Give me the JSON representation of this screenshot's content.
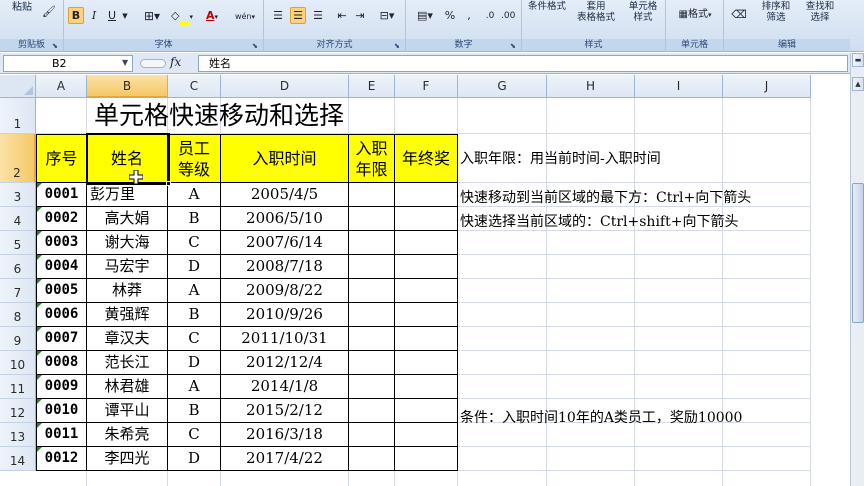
{
  "ribbon": {
    "clipboard": {
      "paste_label": "粘贴",
      "group_label": "剪贴板"
    },
    "font": {
      "bold": "B",
      "italic": "I",
      "underline": "U",
      "font_color_glyph": "A",
      "highlight_glyph": "A",
      "wen_glyph": "wén",
      "group_label": "字体"
    },
    "alignment": {
      "group_label": "对齐方式"
    },
    "number": {
      "percent": "%",
      "comma": ",",
      "group_label": "数字"
    },
    "styles": {
      "conditional_format": "条件格式",
      "table_format_1": "套用",
      "table_format_2": "表格格式",
      "cell_style_1": "单元格",
      "cell_style_2": "样式",
      "group_label": "样式"
    },
    "cells": {
      "format_label": "格式",
      "group_label": "单元格"
    },
    "editing": {
      "sort_filter_1": "排序和",
      "sort_filter_2": "筛选",
      "find_select_1": "查找和",
      "find_select_2": "选择",
      "group_label": "编辑"
    }
  },
  "formula_bar": {
    "name_box": "B2",
    "fx": "fx",
    "content": "姓名"
  },
  "columns": [
    "A",
    "B",
    "C",
    "D",
    "E",
    "F",
    "G",
    "H",
    "I",
    "J"
  ],
  "rows": [
    "1",
    "2",
    "3",
    "4",
    "5",
    "6",
    "7",
    "8",
    "9",
    "10",
    "11",
    "12",
    "13",
    "14"
  ],
  "sheet": {
    "title": "单元格快速移动和选择",
    "headers": {
      "seq": "序号",
      "name": "姓名",
      "grade_1": "员工",
      "grade_2": "等级",
      "hire_date": "入职时间",
      "years_1": "入职",
      "years_2": "年限",
      "bonus": "年终奖"
    },
    "records": [
      {
        "id": "0001",
        "name": "彭万里",
        "grade": "A",
        "date": "2005/4/5"
      },
      {
        "id": "0002",
        "name": "高大娟",
        "grade": "B",
        "date": "2006/5/10"
      },
      {
        "id": "0003",
        "name": "谢大海",
        "grade": "C",
        "date": "2007/6/14"
      },
      {
        "id": "0004",
        "name": "马宏宇",
        "grade": "D",
        "date": "2008/7/18"
      },
      {
        "id": "0005",
        "name": "林莽",
        "grade": "A",
        "date": "2009/8/22"
      },
      {
        "id": "0006",
        "name": "黄强辉",
        "grade": "B",
        "date": "2010/9/26"
      },
      {
        "id": "0007",
        "name": "章汉夫",
        "grade": "C",
        "date": "2011/10/31"
      },
      {
        "id": "0008",
        "name": "范长江",
        "grade": "D",
        "date": "2012/12/4"
      },
      {
        "id": "0009",
        "name": "林君雄",
        "grade": "A",
        "date": "2014/1/8"
      },
      {
        "id": "0010",
        "name": "谭平山",
        "grade": "B",
        "date": "2015/2/12"
      },
      {
        "id": "0011",
        "name": "朱希亮",
        "grade": "C",
        "date": "2016/3/18"
      },
      {
        "id": "0012",
        "name": "李四光",
        "grade": "D",
        "date": "2017/4/22"
      }
    ],
    "notes": {
      "years_formula": "入职年限：用当前时间-入职时间",
      "move_tip": "快速移动到当前区域的最下方：Ctrl+向下箭头",
      "select_tip": "快速选择当前区域的：Ctrl+shift+向下箭头",
      "condition": "条件：入职时间10年的A类员工，奖励10000"
    }
  },
  "colors": {
    "header_fill": "#ffff00",
    "selection_header": "#f5c866",
    "ribbon": "#cfdef0"
  }
}
